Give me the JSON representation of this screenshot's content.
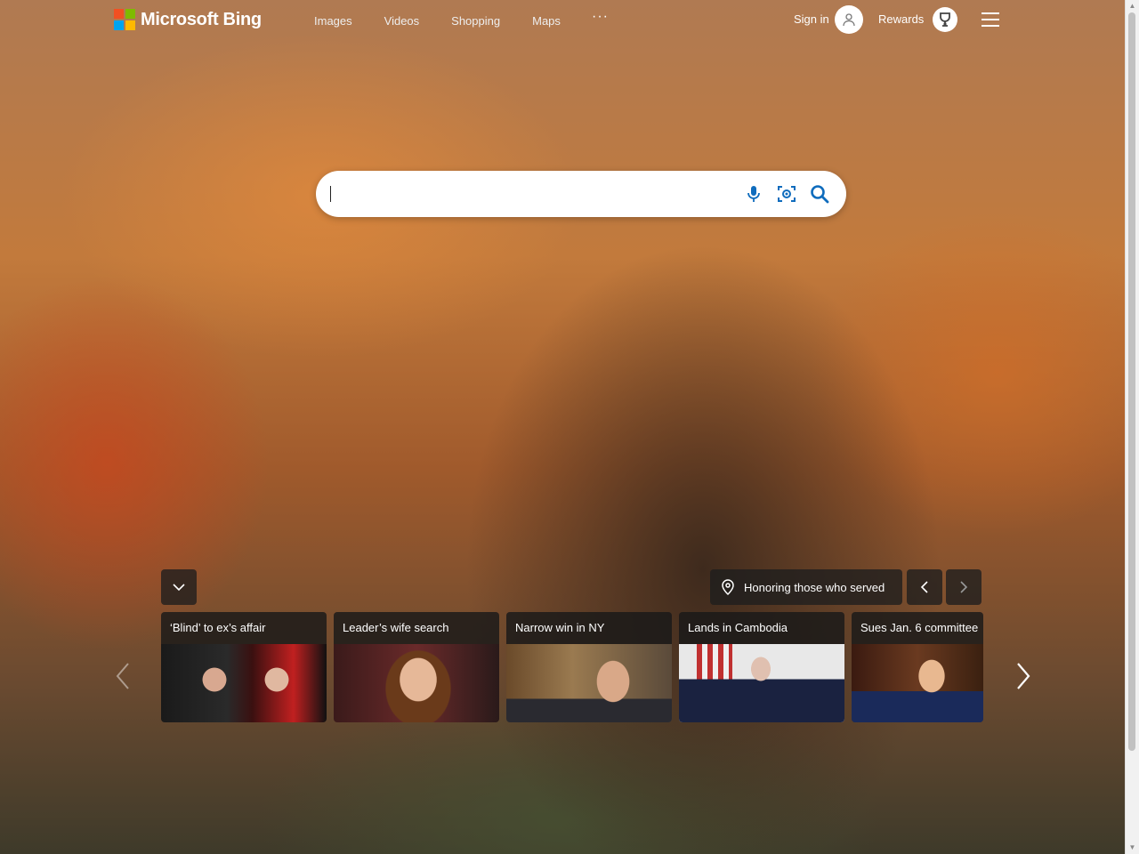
{
  "brand": {
    "name": "Microsoft Bing",
    "colors": [
      "#f25022",
      "#7fba00",
      "#00a4ef",
      "#ffb900"
    ]
  },
  "nav": {
    "items": [
      "Images",
      "Videos",
      "Shopping",
      "Maps"
    ],
    "more": "···"
  },
  "account": {
    "signin": "Sign in",
    "rewards": "Rewards"
  },
  "search": {
    "value": "",
    "placeholder": "",
    "accent": "#0f6cbd"
  },
  "image_of_day": {
    "caption": "Honoring those who served"
  },
  "news": [
    {
      "title": "‘Blind’ to ex’s affair"
    },
    {
      "title": "Leader’s wife search"
    },
    {
      "title": "Narrow win in NY"
    },
    {
      "title": "Lands in Cambodia"
    },
    {
      "title": "Sues Jan. 6 committee"
    }
  ]
}
